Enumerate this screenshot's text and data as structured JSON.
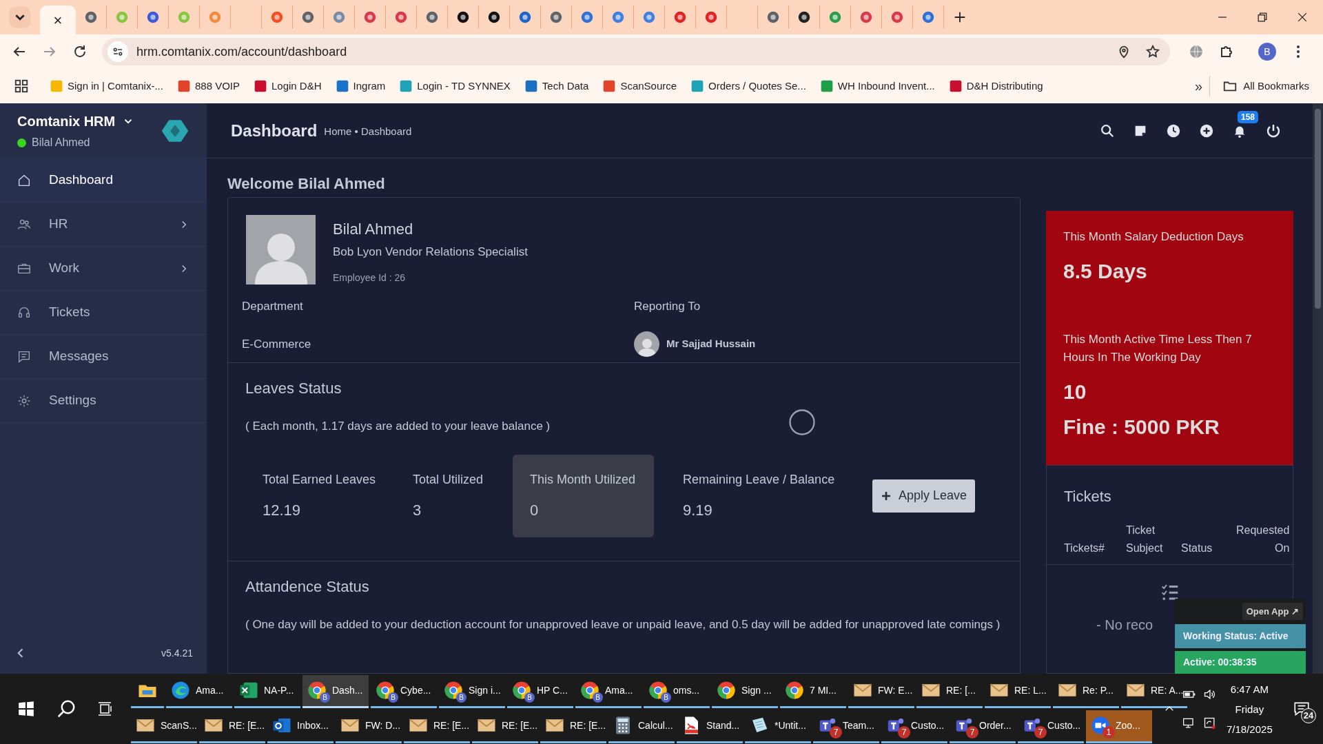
{
  "browser": {
    "tabs": [
      {
        "kind": "active",
        "selected": true,
        "close": "×"
      },
      {
        "kind": "favicon",
        "selected": false,
        "color": "#5f6368"
      },
      {
        "kind": "favicon",
        "selected": false,
        "color": "#8bc53f"
      },
      {
        "kind": "favicon",
        "selected": false,
        "color": "#3b5bdb"
      },
      {
        "kind": "favicon",
        "selected": false,
        "color": "#8bc53f"
      },
      {
        "kind": "favicon",
        "selected": false,
        "color": "#f08a3c"
      },
      {
        "kind": "blank",
        "selected": false
      },
      {
        "kind": "favicon",
        "selected": false,
        "color": "#f25022"
      },
      {
        "kind": "favicon",
        "selected": false,
        "color": "#5f6368"
      },
      {
        "kind": "favicon",
        "selected": false,
        "color": "#7a8aa0"
      },
      {
        "kind": "favicon",
        "selected": false,
        "color": "#d93a4a"
      },
      {
        "kind": "favicon",
        "selected": false,
        "color": "#d93a4a"
      },
      {
        "kind": "favicon",
        "selected": false,
        "color": "#5f6368"
      },
      {
        "kind": "favicon",
        "selected": false,
        "color": "#111111"
      },
      {
        "kind": "favicon",
        "selected": false,
        "color": "#111111"
      },
      {
        "kind": "favicon",
        "selected": false,
        "color": "#1e63c8"
      },
      {
        "kind": "favicon",
        "selected": false,
        "color": "#5f6368"
      },
      {
        "kind": "favicon",
        "selected": false,
        "color": "#2f6fd8"
      },
      {
        "kind": "favicon",
        "selected": false,
        "color": "#3f7fe0"
      },
      {
        "kind": "favicon",
        "selected": false,
        "color": "#3f7fe0"
      },
      {
        "kind": "favicon",
        "selected": false,
        "color": "#e02424"
      },
      {
        "kind": "favicon",
        "selected": false,
        "color": "#e02424"
      },
      {
        "kind": "blank",
        "selected": false
      },
      {
        "kind": "favicon",
        "selected": false,
        "color": "#5f6368"
      },
      {
        "kind": "favicon",
        "selected": false,
        "color": "#222222"
      },
      {
        "kind": "favicon",
        "selected": false,
        "color": "#2e9e4a"
      },
      {
        "kind": "favicon",
        "selected": false,
        "color": "#d93a4a"
      },
      {
        "kind": "favicon",
        "selected": false,
        "color": "#d93a4a"
      },
      {
        "kind": "favicon",
        "selected": false,
        "color": "#2f6fd8"
      }
    ],
    "url": "hrm.comtanix.com/account/dashboard",
    "profile": "B",
    "bookmarks": [
      {
        "label": "Sign in | Comtanix-...",
        "color": "#f5b800"
      },
      {
        "label": "888 VOIP",
        "color": "#e0452b"
      },
      {
        "label": "Login D&H",
        "color": "#c8102e"
      },
      {
        "label": "Ingram",
        "color": "#1a73c8"
      },
      {
        "label": "Login - TD SYNNEX",
        "color": "#1fa3b5"
      },
      {
        "label": "Tech Data",
        "color": "#1a6fc0"
      },
      {
        "label": "ScanSource",
        "color": "#e0452b"
      },
      {
        "label": "Orders / Quotes Se...",
        "color": "#1fa3b5"
      },
      {
        "label": "WH Inbound Invent...",
        "color": "#1e9e48"
      },
      {
        "label": "D&H Distributing",
        "color": "#c8102e"
      }
    ],
    "more": "»",
    "all_bookmarks": "All Bookmarks"
  },
  "sidebar": {
    "title": "Comtanix HRM",
    "user": "Bilal Ahmed",
    "online": true,
    "items": [
      {
        "label": "Dashboard",
        "kind": "home",
        "selected": true,
        "expandable": false
      },
      {
        "label": "HR",
        "kind": "people",
        "selected": false,
        "expandable": true
      },
      {
        "label": "Work",
        "kind": "briefcase",
        "selected": false,
        "expandable": true
      },
      {
        "label": "Tickets",
        "kind": "headset",
        "selected": false,
        "expandable": false
      },
      {
        "label": "Messages",
        "kind": "message",
        "selected": false,
        "expandable": false
      },
      {
        "label": "Settings",
        "kind": "gear",
        "selected": false,
        "expandable": false
      }
    ],
    "version": "v5.4.21"
  },
  "header": {
    "title": "Dashboard",
    "breadcrumb": "Home • Dashboard",
    "notifications": "158"
  },
  "welcome": "Welcome Bilal Ahmed",
  "profile": {
    "name": "Bilal Ahmed",
    "role": "Bob Lyon Vendor Relations Specialist",
    "employee_id": "Employee Id : 26",
    "department_label": "Department",
    "department": "E-Commerce",
    "reporting_label": "Reporting To",
    "reporting": "Mr Sajjad Hussain"
  },
  "leaves": {
    "title": "Leaves Status",
    "note": "( Each month, 1.17 days are added to your leave balance )",
    "loading": true,
    "stats": [
      {
        "label": "Total Earned Leaves",
        "value": "12.19",
        "selected": false
      },
      {
        "label": "Total Utilized",
        "value": "3",
        "selected": false
      },
      {
        "label": "This Month Utilized",
        "value": "0",
        "selected": true
      },
      {
        "label": "Remaining Leave / Balance",
        "value": "9.19",
        "selected": false
      }
    ],
    "button": "Apply Leave"
  },
  "attendance": {
    "title": "Attandence Status",
    "note": "( One day will be added to your deduction account for unapproved leave or unpaid leave, and 0.5 day will be added for unapproved late comings )"
  },
  "deductions": {
    "title": "This Month Salary Deduction Days",
    "value": "8.5 Days",
    "title_2": "This Month Active Time Less Then 7 Hours In The Working Day",
    "value_2": "10",
    "fine": "Fine : 5000 PKR"
  },
  "tickets": {
    "title": "Tickets",
    "columns": [
      "Tickets#",
      "Ticket Subject",
      "Status",
      "Requested On"
    ],
    "empty": "- No reco"
  },
  "tracker": {
    "open": "Open App ↗",
    "status": "Working Status: Active",
    "active": "Active: 00:38:35"
  },
  "taskbar": {
    "row_1": [
      {
        "kind": "explorer",
        "selected": false,
        "attention": false
      },
      {
        "label": "Ama...",
        "kind": "edge",
        "selected": false,
        "attention": false
      },
      {
        "label": "NA-P...",
        "kind": "excel",
        "selected": false,
        "attention": false
      },
      {
        "label": "Dash...",
        "kind": "chrome",
        "profile": "B",
        "selected": true,
        "attention": false
      },
      {
        "label": "Cybe...",
        "kind": "chrome",
        "profile": "B",
        "selected": false,
        "attention": false
      },
      {
        "label": "Sign i...",
        "kind": "chrome",
        "profile": "B",
        "selected": false,
        "attention": false
      },
      {
        "label": "HP C...",
        "kind": "chrome",
        "profile": "B",
        "selected": false,
        "attention": false
      },
      {
        "label": "Ama...",
        "kind": "chrome",
        "profile": "B",
        "selected": false,
        "attention": false
      },
      {
        "label": "oms...",
        "kind": "chrome",
        "profile": "B",
        "selected": false,
        "attention": false
      },
      {
        "label": "Sign ...",
        "kind": "chrome",
        "selected": false,
        "attention": false
      },
      {
        "label": "7 MI...",
        "kind": "chrome",
        "selected": false,
        "attention": false
      },
      {
        "label": "FW: E...",
        "kind": "mail",
        "selected": false,
        "attention": false
      },
      {
        "label": "RE: [...",
        "kind": "mail",
        "selected": false,
        "attention": false
      },
      {
        "label": "RE: L...",
        "kind": "mail",
        "selected": false,
        "attention": false
      },
      {
        "label": "Re: P...",
        "kind": "mail",
        "selected": false,
        "attention": false
      },
      {
        "label": "RE: A...",
        "kind": "mail",
        "selected": false,
        "attention": false
      }
    ],
    "row_2": [
      {
        "label": "ScanS...",
        "kind": "mail",
        "selected": false,
        "attention": false
      },
      {
        "label": "RE: [E...",
        "kind": "mail",
        "selected": false,
        "attention": false
      },
      {
        "label": "Inbox...",
        "kind": "outlook",
        "selected": false,
        "attention": false
      },
      {
        "label": "FW: D...",
        "kind": "mail",
        "selected": false,
        "attention": false
      },
      {
        "label": "RE: [E...",
        "kind": "mail",
        "selected": false,
        "attention": false
      },
      {
        "label": "RE: [E...",
        "kind": "mail",
        "selected": false,
        "attention": false
      },
      {
        "label": "RE: [E...",
        "kind": "mail",
        "selected": false,
        "attention": false
      },
      {
        "label": "Calcul...",
        "kind": "calculator",
        "selected": false,
        "attention": false
      },
      {
        "label": "Stand...",
        "kind": "pdf",
        "selected": false,
        "attention": false
      },
      {
        "label": "*Untit...",
        "kind": "notepad",
        "selected": false,
        "attention": false
      },
      {
        "label": "Team...",
        "kind": "teams",
        "badge": "7",
        "selected": false,
        "attention": false
      },
      {
        "label": "Custo...",
        "kind": "teams",
        "badge": "7",
        "selected": false,
        "attention": false
      },
      {
        "label": "Order...",
        "kind": "teams",
        "badge": "7",
        "selected": false,
        "attention": false
      },
      {
        "label": "Custo...",
        "kind": "teams",
        "badge": "7",
        "selected": false,
        "attention": false
      },
      {
        "label": "Zoo...",
        "kind": "zoom",
        "badge": "1",
        "selected": false,
        "attention": true
      }
    ],
    "time": "6:47 AM",
    "day": "Friday",
    "date": "7/18/2025",
    "notifications": "24"
  }
}
